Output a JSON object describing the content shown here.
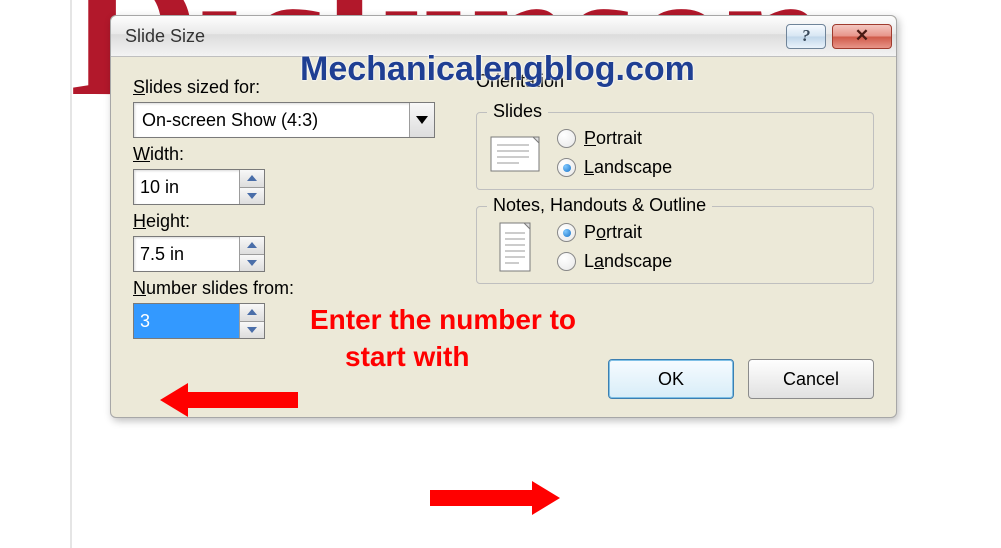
{
  "background_word": "Dickinson",
  "watermark": "Mechanicalengblog.com",
  "dialog": {
    "title": "Slide Size",
    "slides_sized_for_label": "Slides sized for:",
    "slides_sized_for_value": "On-screen Show (4:3)",
    "width_label": "Width:",
    "width_value": "10 in",
    "height_label": "Height:",
    "height_value": "7.5 in",
    "number_from_label": "Number slides from:",
    "number_from_value": "3",
    "orientation_label": "Orientation",
    "slides_group": "Slides",
    "notes_group": "Notes, Handouts & Outline",
    "portrait": "Portrait",
    "landscape": "Landscape",
    "slides_selected": "landscape",
    "notes_selected": "portrait",
    "ok": "OK",
    "cancel": "Cancel",
    "help_glyph": "?",
    "close_glyph": "✕"
  },
  "annotation": {
    "line1": "Enter the number to",
    "line2": "start with"
  }
}
